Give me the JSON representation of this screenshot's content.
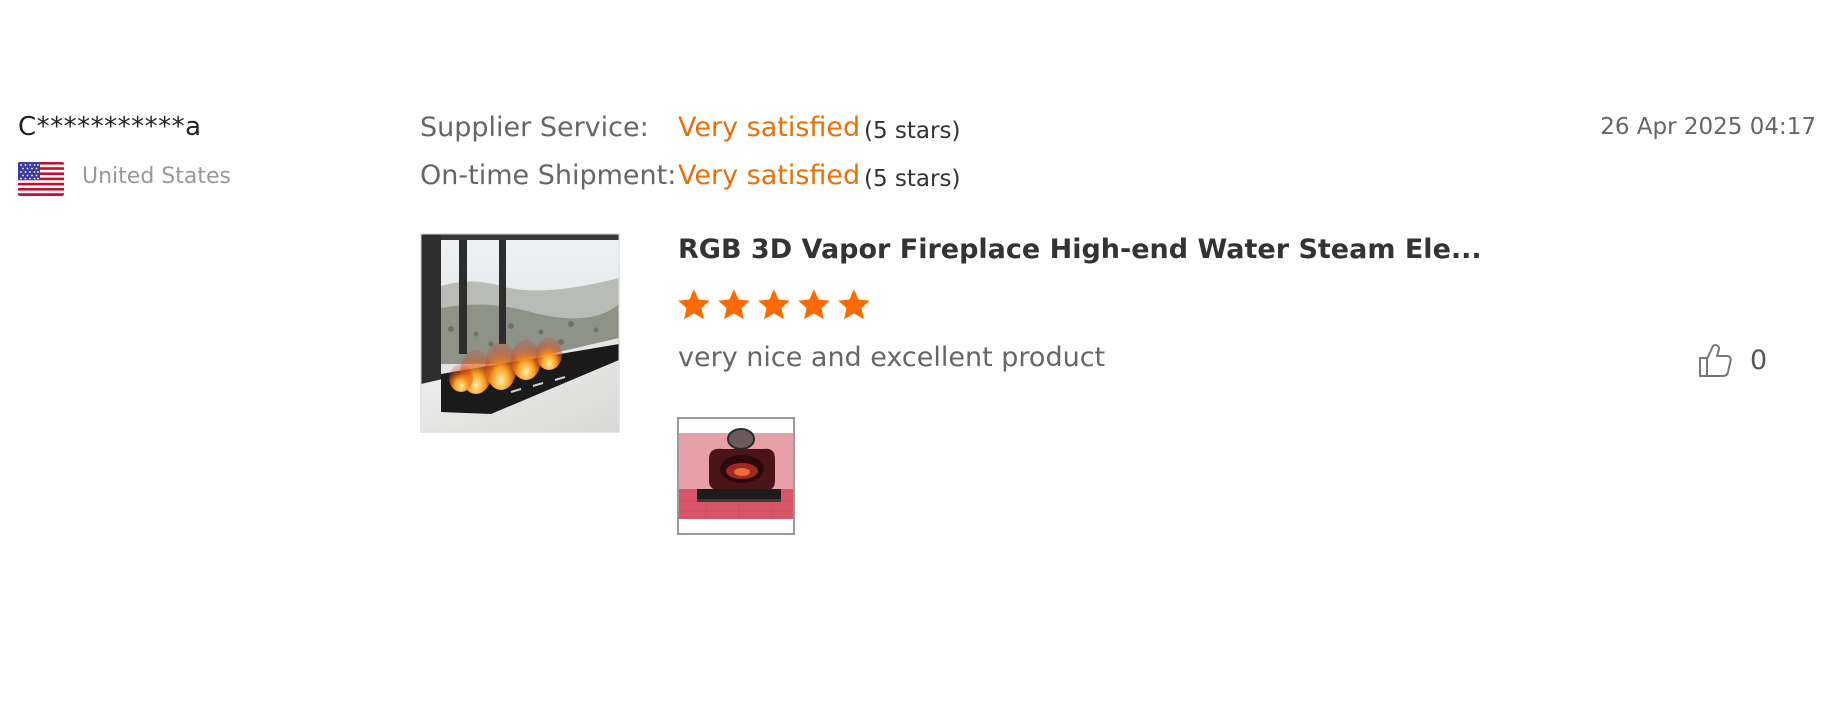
{
  "reviewer": {
    "name": "C***********a",
    "country": "United States",
    "flag_icon": "us-flag-icon"
  },
  "ratings": [
    {
      "label": "Supplier Service:",
      "value": "Very satisfied",
      "stars_text": "(5 stars)"
    },
    {
      "label": "On-time Shipment:",
      "value": "Very satisfied",
      "stars_text": "(5 stars)"
    }
  ],
  "date": "26 Apr 2025 04:17",
  "product": {
    "title": "RGB 3D Vapor Fireplace High-end Water Steam Ele...",
    "rating": 5,
    "rating_max": 5
  },
  "comment": "very nice and excellent product",
  "helpful": {
    "icon": "thumbs-up-icon",
    "count": "0"
  },
  "colors": {
    "accent": "#e8700a",
    "star": "#ff6a00",
    "muted": "#999999"
  }
}
